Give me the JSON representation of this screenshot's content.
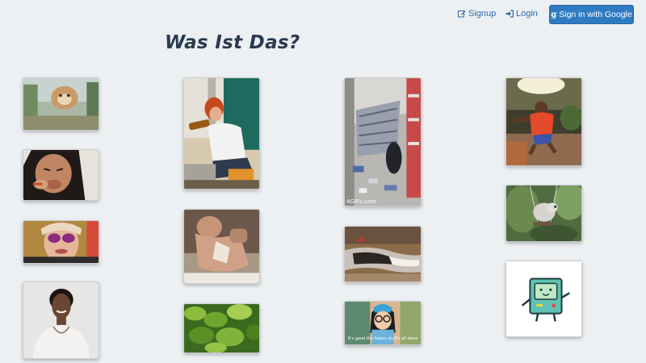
{
  "nav": {
    "signup_label": "Signup",
    "login_label": "Login",
    "google_glyph": "g",
    "google_label": "Sign in with Google"
  },
  "page": {
    "title": "Was Ist Das?"
  },
  "gallery": {
    "store_watermark": "4GIFs.com",
    "cartoon_subtitle": "It's good the heavy stuff's all done"
  },
  "colors": {
    "background": "#edf0f2",
    "brand_blue": "#2f7bc2",
    "link_blue": "#2b6aa8",
    "title_navy": "#2a3a50"
  }
}
